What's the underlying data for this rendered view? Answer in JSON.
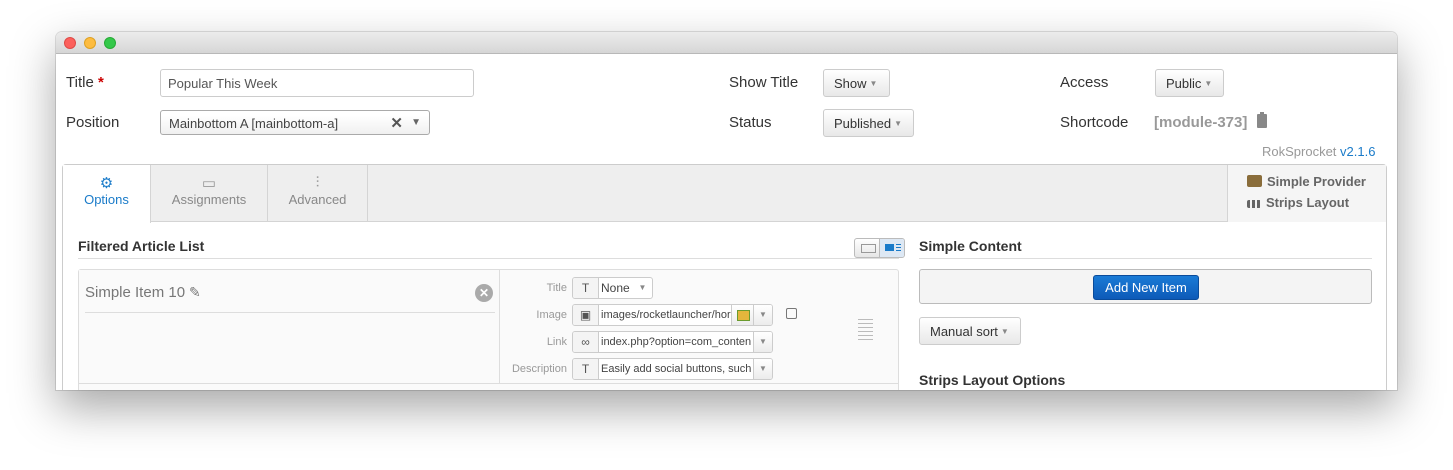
{
  "form": {
    "title_label": "Title",
    "required_mark": "*",
    "title_value": "Popular This Week",
    "position_label": "Position",
    "position_value": "Mainbottom A [mainbottom-a]",
    "show_title_label": "Show Title",
    "show_title_value": "Show",
    "status_label": "Status",
    "status_value": "Published",
    "access_label": "Access",
    "access_value": "Public",
    "shortcode_label": "Shortcode",
    "shortcode_value": "[module-373]",
    "brand": "RokSprocket",
    "version": "v2.1.6"
  },
  "tabs": [
    {
      "label": "Options",
      "icon": "gear-icon",
      "active": true
    },
    {
      "label": "Assignments",
      "icon": "assignments-icon",
      "active": false
    },
    {
      "label": "Advanced",
      "icon": "sliders-icon",
      "active": false
    }
  ],
  "provider": {
    "provider_label": "Simple Provider",
    "layout_label": "Strips Layout"
  },
  "filtered_list": {
    "title": "Filtered Article List",
    "item": {
      "name": "Simple Item 10",
      "fields": [
        {
          "label": "Title",
          "icon": "text-icon",
          "value": "None"
        },
        {
          "label": "Image",
          "icon": "image-icon",
          "value": "images/rocketlauncher/hor"
        },
        {
          "label": "Link",
          "icon": "link-icon",
          "value": "index.php?option=com_conten"
        },
        {
          "label": "Description",
          "icon": "text-icon",
          "value": "Easily add social buttons, such"
        }
      ]
    }
  },
  "simple_content": {
    "title": "Simple Content",
    "add_button": "Add New Item",
    "sort_value": "Manual sort",
    "options_title": "Strips Layout Options"
  },
  "colors": {
    "accent": "#1a7bc9",
    "primary_button": "#0d5ab8",
    "required": "#cc0000"
  }
}
